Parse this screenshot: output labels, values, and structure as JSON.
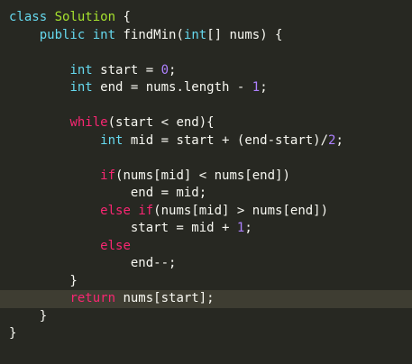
{
  "editor": {
    "lines": [
      [
        {
          "t": "class",
          "c": "kw-blue"
        },
        {
          "t": " ",
          "c": "plain"
        },
        {
          "t": "Solution",
          "c": "cls"
        },
        {
          "t": " {",
          "c": "plain"
        }
      ],
      [
        {
          "t": "    ",
          "c": "plain"
        },
        {
          "t": "public",
          "c": "kw-blue"
        },
        {
          "t": " ",
          "c": "plain"
        },
        {
          "t": "int",
          "c": "kw-blue"
        },
        {
          "t": " findMin(",
          "c": "plain"
        },
        {
          "t": "int",
          "c": "kw-blue"
        },
        {
          "t": "[] nums) {",
          "c": "plain"
        }
      ],
      [],
      [
        {
          "t": "        ",
          "c": "plain"
        },
        {
          "t": "int",
          "c": "kw-blue"
        },
        {
          "t": " start = ",
          "c": "plain"
        },
        {
          "t": "0",
          "c": "num"
        },
        {
          "t": ";",
          "c": "plain"
        }
      ],
      [
        {
          "t": "        ",
          "c": "plain"
        },
        {
          "t": "int",
          "c": "kw-blue"
        },
        {
          "t": " end = nums.length - ",
          "c": "plain"
        },
        {
          "t": "1",
          "c": "num"
        },
        {
          "t": ";",
          "c": "plain"
        }
      ],
      [],
      [
        {
          "t": "        ",
          "c": "plain"
        },
        {
          "t": "while",
          "c": "kw-pink"
        },
        {
          "t": "(start < end){",
          "c": "plain"
        }
      ],
      [
        {
          "t": "            ",
          "c": "plain"
        },
        {
          "t": "int",
          "c": "kw-blue"
        },
        {
          "t": " mid = start + (end-start)/",
          "c": "plain"
        },
        {
          "t": "2",
          "c": "num"
        },
        {
          "t": ";",
          "c": "plain"
        }
      ],
      [],
      [
        {
          "t": "            ",
          "c": "plain"
        },
        {
          "t": "if",
          "c": "kw-pink"
        },
        {
          "t": "(nums[mid] < nums[end])",
          "c": "plain"
        }
      ],
      [
        {
          "t": "                end = mid;",
          "c": "plain"
        }
      ],
      [
        {
          "t": "            ",
          "c": "plain"
        },
        {
          "t": "else",
          "c": "kw-pink"
        },
        {
          "t": " ",
          "c": "plain"
        },
        {
          "t": "if",
          "c": "kw-pink"
        },
        {
          "t": "(nums[mid] > nums[end])",
          "c": "plain"
        }
      ],
      [
        {
          "t": "                start = mid + ",
          "c": "plain"
        },
        {
          "t": "1",
          "c": "num"
        },
        {
          "t": ";",
          "c": "plain"
        }
      ],
      [
        {
          "t": "            ",
          "c": "plain"
        },
        {
          "t": "else",
          "c": "kw-pink"
        }
      ],
      [
        {
          "t": "                end--;",
          "c": "plain"
        }
      ],
      [
        {
          "t": "        }",
          "c": "plain"
        }
      ],
      [
        {
          "t": "        ",
          "c": "plain"
        },
        {
          "t": "return",
          "c": "kw-pink"
        },
        {
          "t": " nums[start];",
          "c": "plain"
        }
      ],
      [
        {
          "t": "    }",
          "c": "plain"
        }
      ],
      [
        {
          "t": "}",
          "c": "plain"
        }
      ]
    ],
    "highlighted_line": 16
  }
}
